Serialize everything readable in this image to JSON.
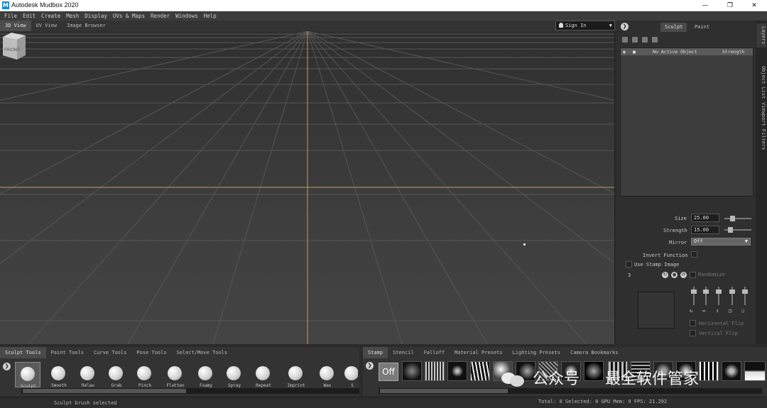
{
  "window": {
    "title": "Autodesk Mudbox 2020",
    "app_icon": "M"
  },
  "menu": [
    "File",
    "Edit",
    "Create",
    "Mesh",
    "Display",
    "UVs & Maps",
    "Render",
    "Windows",
    "Help"
  ],
  "viewport_tabs": [
    "3D View",
    "UV View",
    "Image Browser"
  ],
  "sign_in": "Sign In",
  "viewcube_label": "FRONT",
  "right_panel": {
    "modes": [
      "Sculpt",
      "Paint"
    ],
    "layer": {
      "name": "No Active Object",
      "column": "Strength"
    },
    "side_tabs": [
      "Layers",
      "Object List",
      "Viewport Filters"
    ],
    "properties": {
      "size_label": "Size",
      "size_value": "25.00",
      "size_fraction": 0.25,
      "strength_label": "Strength",
      "strength_value": "15.00",
      "strength_fraction": 0.15,
      "mirror_label": "Mirror",
      "mirror_value": "Off",
      "invert_label": "Invert Function",
      "use_stamp_label": "Use Stamp Image",
      "stamp_index": "3",
      "randomize_label": "Randomize",
      "hflip_label": "Horizontal Flip",
      "vflip_label": "Vertical Flip"
    }
  },
  "tool_tabs": [
    "Sculpt Tools",
    "Paint Tools",
    "Curve Tools",
    "Pose Tools",
    "Select/Move Tools"
  ],
  "tools": [
    "Sculpt",
    "Smooth",
    "Relax",
    "Grab",
    "Pinch",
    "Flatten",
    "Foamy",
    "Spray",
    "Repeat",
    "Imprint",
    "Wax",
    "S"
  ],
  "stamp_tabs": [
    "Stamp",
    "Stencil",
    "Falloff",
    "Material Presets",
    "Lighting Presets",
    "Camera Bookmarks"
  ],
  "stamp_off": "Off",
  "status": {
    "message": "Sculpt brush selected",
    "stats": "Total: 0  Selected: 0 GPU Mem: 9  FPS: 21.292"
  },
  "watermark": {
    "text1": "公众号",
    "text2": "最全软件管家"
  },
  "colors": {
    "accent": "#c8a03a",
    "grid": "#5a5a5a",
    "selection": "#5a5a5a"
  }
}
